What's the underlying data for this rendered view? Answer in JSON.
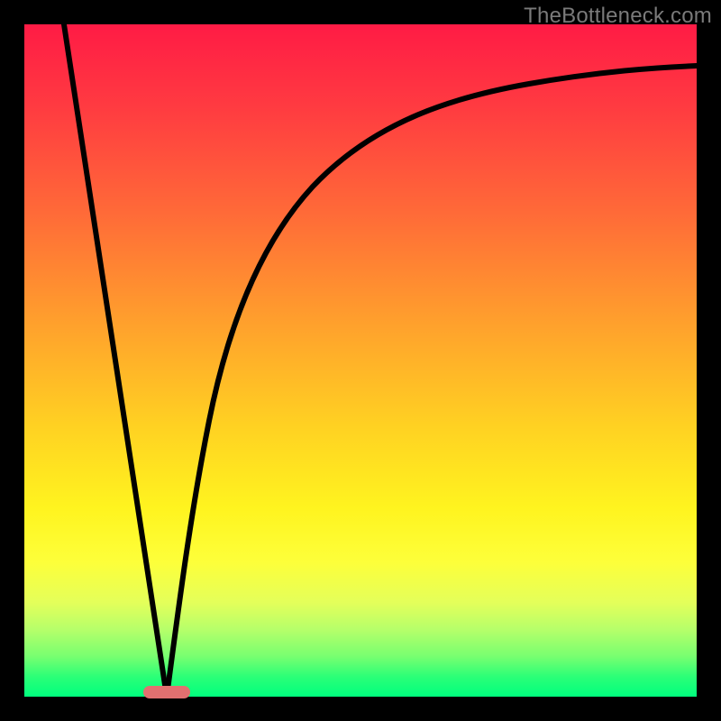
{
  "watermark": "TheBottleneck.com",
  "chart_data": {
    "type": "line",
    "title": "",
    "xlabel": "",
    "ylabel": "",
    "xlim": [
      0,
      100
    ],
    "ylim": [
      0,
      100
    ],
    "grid": false,
    "legend": false,
    "series": [
      {
        "name": "left-line",
        "x": [
          6,
          21
        ],
        "values": [
          100,
          0
        ]
      },
      {
        "name": "right-curve",
        "x": [
          21,
          23,
          26,
          30,
          35,
          42,
          50,
          60,
          72,
          85,
          100
        ],
        "values": [
          0,
          18,
          35,
          50,
          62,
          72,
          79,
          84,
          88,
          91,
          93
        ]
      }
    ],
    "marker": {
      "name": "optimal-range",
      "x_start": 18,
      "x_end": 25,
      "y": 0
    },
    "background_gradient": {
      "top": "#ff1b45",
      "mid": "#fff41f",
      "bottom": "#00ff7e"
    }
  }
}
